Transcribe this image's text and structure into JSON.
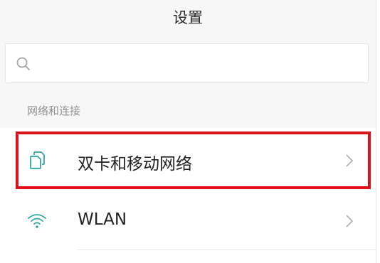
{
  "header": {
    "title": "设置"
  },
  "search": {
    "icon": "search-icon"
  },
  "sections": [
    {
      "title": "网络和连接",
      "items": [
        {
          "label": "双卡和移动网络",
          "icon": "dual-sim-icon",
          "highlighted": true
        },
        {
          "label": "WLAN",
          "icon": "wifi-icon"
        }
      ]
    }
  ],
  "colors": {
    "accent": "#2fa8a0",
    "highlight_border": "#e0101a",
    "background": "#f7f7f7"
  }
}
